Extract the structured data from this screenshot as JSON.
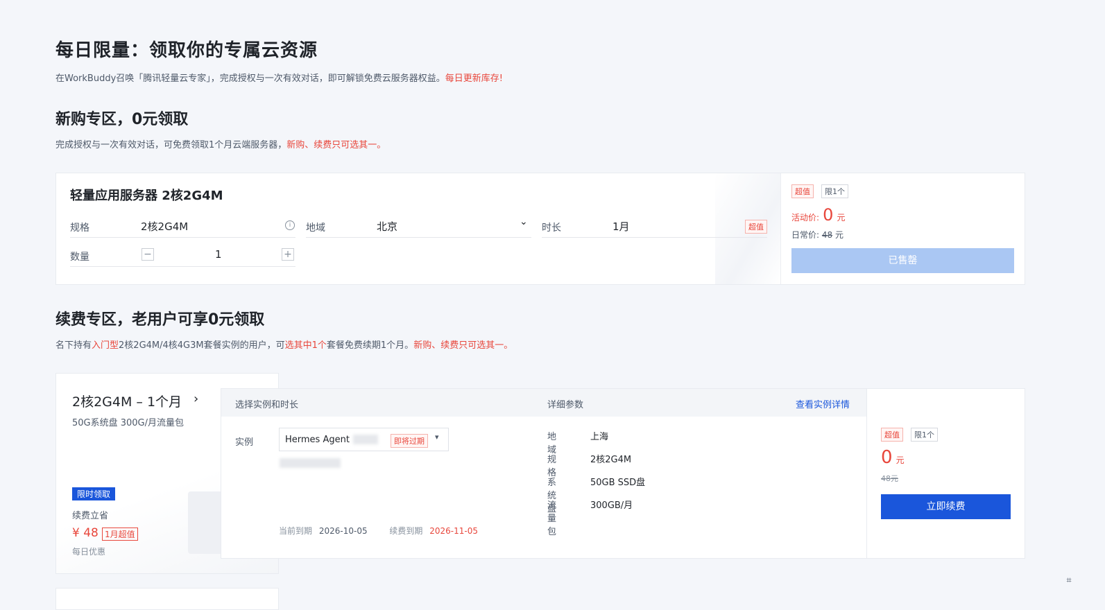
{
  "hero": {
    "title": "每日限量：领取你的专属云资源",
    "desc_main": "在WorkBuddy召唤「腾讯轻量云专家」，完成授权与一次有效对话，即可解锁免费云服务器权益。",
    "desc_highlight": "每日更新库存!"
  },
  "new_section": {
    "title": "新购专区，0元领取",
    "desc_main": "完成授权与一次有效对话，可免费领取1个月云端服务器，",
    "desc_highlight": "新购、续费只可选其一。"
  },
  "new_card": {
    "product_title": "轻量应用服务器 2核2G4M",
    "spec_label": "规格",
    "spec_value": "2核2G4M",
    "info_icon": "info-icon",
    "region_label": "地域",
    "region_value": "北京",
    "duration_label": "时长",
    "duration_value": "1月",
    "duration_tag": "超值",
    "qty_label": "数量",
    "qty_minus": "−",
    "qty_value": "1",
    "qty_plus": "+",
    "tag_value": "超值",
    "tag_limit": "限1个",
    "promo_label": "活动价:",
    "promo_price": "0",
    "promo_unit": "元",
    "normal_label": "日常价:",
    "normal_price": "48",
    "normal_unit": "元",
    "button_label": "已售罄"
  },
  "renew_section": {
    "title": "续费专区，老用户可享0元领取",
    "desc_1": "名下持有",
    "desc_2": "入门型",
    "desc_3": "2核2G4M/4核4G3M套餐实例的用户，可",
    "desc_4": "选其中1个",
    "desc_5": "套餐免费续期1个月。",
    "desc_6": "新购、续费只可选其一。"
  },
  "renew_left": {
    "title": "2核2G4M – 1个月",
    "subtitle": "50G系统盘 300G/月流量包",
    "badge": "限时领取",
    "caption": "续费立省",
    "price": "¥ 48",
    "price_tag": "1月超值",
    "footer": "每日优惠"
  },
  "renew_panel": {
    "head_left": "选择实例和时长",
    "head_mid": "详细参数",
    "head_link": "查看实例详情",
    "instance_label": "实例",
    "instance_value": "Hermes Agent",
    "instance_tag": "即将过期",
    "current_expiry_label": "当前到期",
    "current_expiry_value": "2026-10-05",
    "renew_expiry_label": "续费到期",
    "renew_expiry_value": "2026-11-05",
    "params": [
      {
        "label": "地域",
        "value": "上海"
      },
      {
        "label": "规格",
        "value": "2核2G4M"
      },
      {
        "label": "系统盘",
        "value": "50GB SSD盘"
      },
      {
        "label": "流量包",
        "value": "300GB/月"
      }
    ]
  },
  "renew_price": {
    "tag_value": "超值",
    "tag_limit": "限1个",
    "price": "0",
    "unit": "元",
    "original": "48元",
    "button_label": "立即续费"
  },
  "colors": {
    "accent": "#1a56db",
    "red": "#e8463b",
    "sold": "#aac7f3"
  }
}
